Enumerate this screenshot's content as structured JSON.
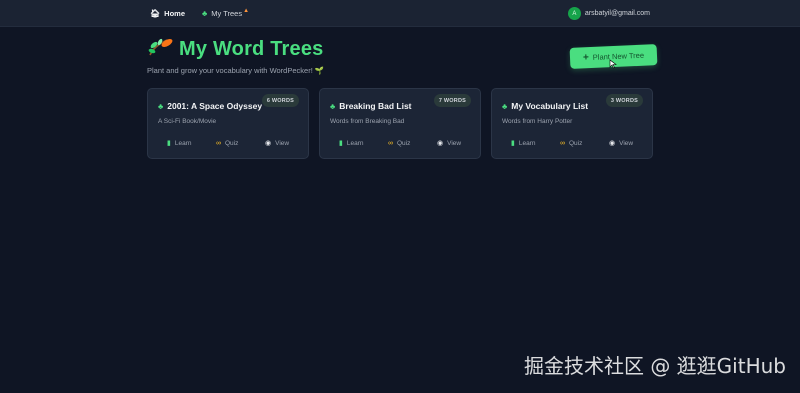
{
  "nav": {
    "home_label": "Home",
    "home_icon": "home-icon",
    "trees_label": "My Trees",
    "trees_icon": "sprout-icon",
    "user_initial": "A",
    "user_email": "arsbatyil@gmail.com"
  },
  "header": {
    "title": "My Word Trees",
    "subtitle": "Plant and grow your vocabulary with WordPecker! 🌱",
    "plant_button_label": "Plant New Tree"
  },
  "trees": [
    {
      "title": "2001: A Space Odyssey",
      "badge": "6 WORDS",
      "description": "A Sci-Fi Book/Movie",
      "learn": "Learn",
      "quiz": "Quiz",
      "view": "View"
    },
    {
      "title": "Breaking Bad List",
      "badge": "7 WORDS",
      "description": "Words from Breaking Bad",
      "learn": "Learn",
      "quiz": "Quiz",
      "view": "View"
    },
    {
      "title": "My Vocabulary List",
      "badge": "3 WORDS",
      "description": "Words from Harry Potter",
      "learn": "Learn",
      "quiz": "Quiz",
      "view": "View"
    }
  ],
  "watermark": "掘金技术社区 @ 逛逛GitHub",
  "colors": {
    "background": "#0f1524",
    "accent": "#4ade80",
    "card": "#1c2536",
    "nav": "#1b2333"
  }
}
